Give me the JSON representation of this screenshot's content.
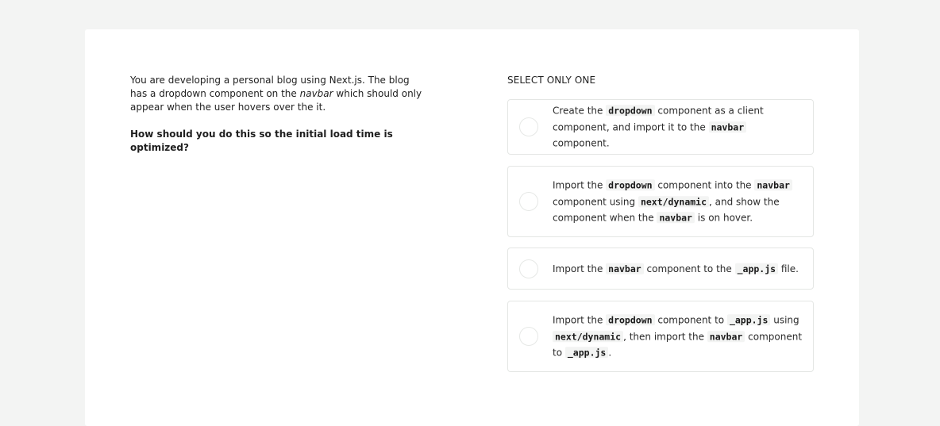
{
  "question": {
    "part1": "You are developing a personal blog using Next.js. The blog has a dropdown component on the ",
    "emphasis": "navbar",
    "part2": " which should only appear when the user hovers over the it.",
    "prompt": "How should you do this so the initial load time is optimized?"
  },
  "select_label": "SELECT ONLY ONE",
  "options": [
    {
      "t1": "Create the ",
      "c1": "dropdown",
      "t2": " component as a client component, and import it to the ",
      "c2": "navbar",
      "t3": " component."
    },
    {
      "t1": "Import the ",
      "c1": "dropdown",
      "t2": " component into the ",
      "c2": "navbar",
      "t3": " component using ",
      "c3": "next/dynamic",
      "t4": ", and show the component when the ",
      "c4": "navbar",
      "t5": " is on hover."
    },
    {
      "t1": "Import the ",
      "c1": "navbar",
      "t2": " component to the ",
      "c2": "_app.js",
      "t3": " file."
    },
    {
      "t1": "Import the ",
      "c1": "dropdown",
      "t2": " component to ",
      "c2": "_app.js",
      "t3": " using ",
      "c3": "next/dynamic",
      "t4": ", then import the ",
      "c4": "navbar",
      "t5": " component to ",
      "c5": "_app.js",
      "t6": "."
    }
  ]
}
